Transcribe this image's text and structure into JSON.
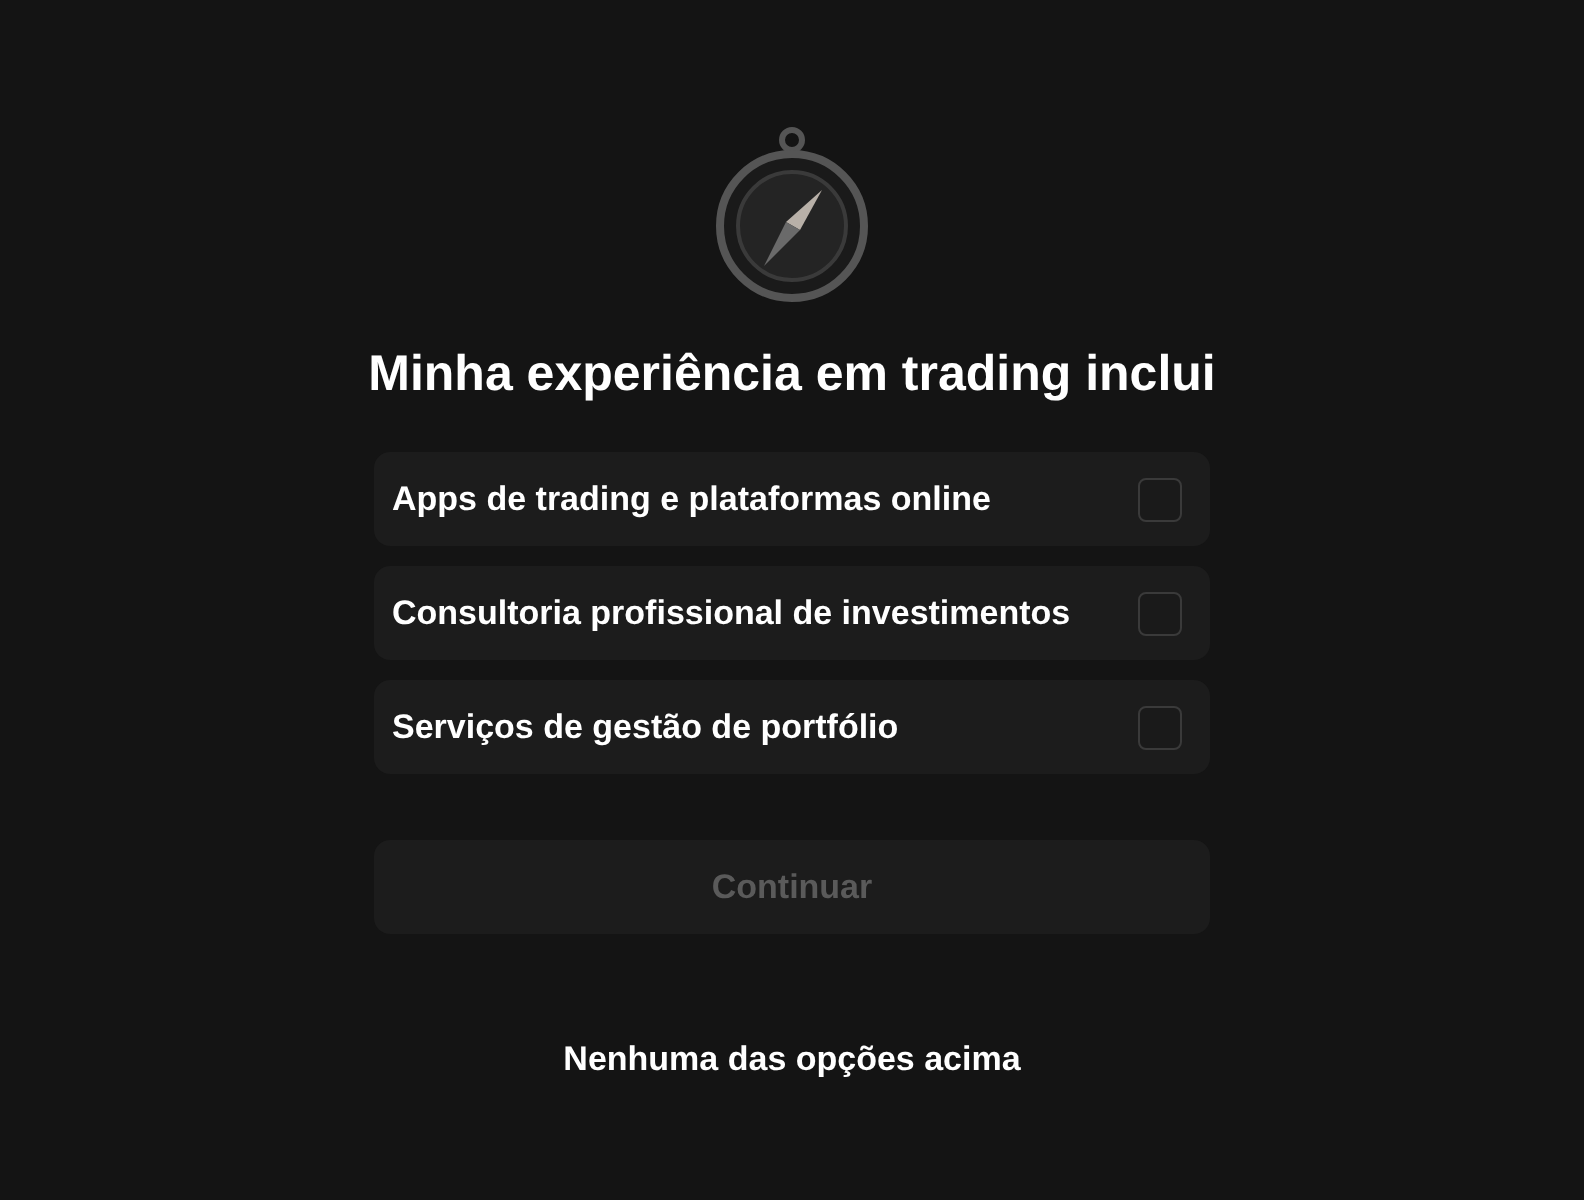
{
  "title": "Minha experiência em trading inclui",
  "options": [
    {
      "label": "Apps de trading e plataformas online",
      "checked": false
    },
    {
      "label": "Consultoria profissional de investimentos",
      "checked": false
    },
    {
      "label": "Serviços de gestão de portfólio",
      "checked": false
    }
  ],
  "continue_button": {
    "label": "Continuar",
    "disabled": true
  },
  "none_link": "Nenhuma das opções acima"
}
